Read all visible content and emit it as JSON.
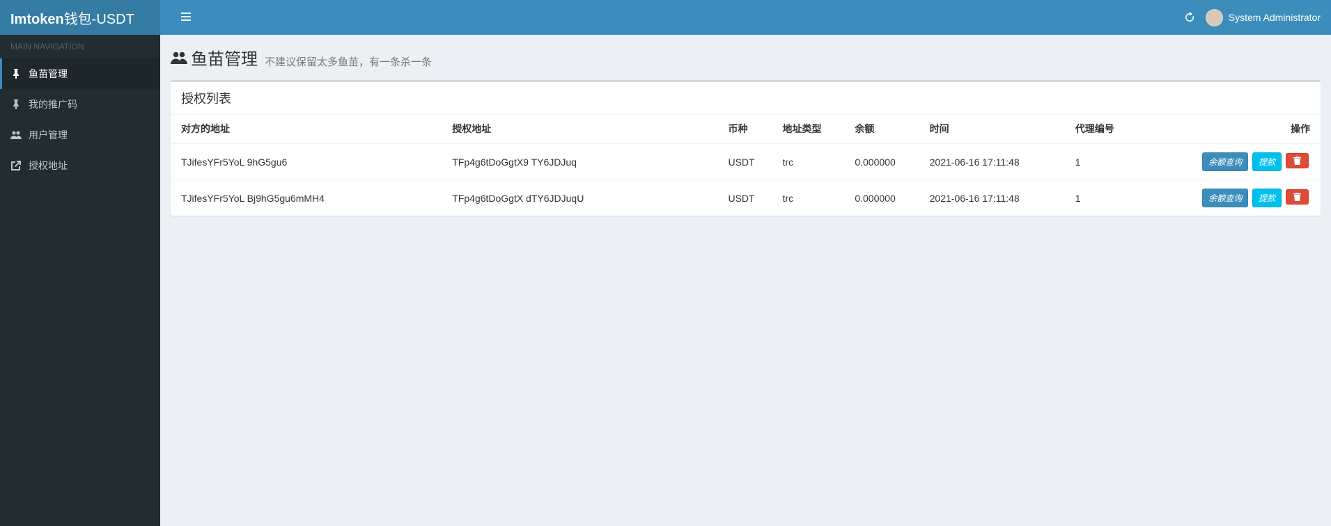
{
  "header": {
    "logo_bold": "Imtoken",
    "logo_rest": "钱包-USDT",
    "user_name": "System Administrator"
  },
  "sidebar": {
    "header": "MAIN NAVIGATION",
    "items": [
      {
        "label": "鱼苗管理",
        "icon": "pin"
      },
      {
        "label": "我的推广码",
        "icon": "pin"
      },
      {
        "label": "用户管理",
        "icon": "users"
      },
      {
        "label": "授权地址",
        "icon": "external"
      }
    ]
  },
  "page": {
    "title": "鱼苗管理",
    "subtitle": "不建议保留太多鱼苗，有一条杀一条"
  },
  "box": {
    "title": "授权列表"
  },
  "table": {
    "headers": {
      "target_address": "对方的地址",
      "auth_address": "授权地址",
      "currency": "币种",
      "addr_type": "地址类型",
      "balance": "余额",
      "time": "时间",
      "agent_id": "代理编号",
      "actions": "操作"
    },
    "rows": [
      {
        "target_address": "TJifesYFr5YoL          9hG5gu6",
        "auth_address": "TFp4g6tDoGgtX9          TY6JDJuq",
        "currency": "USDT",
        "addr_type": "trc",
        "balance": "0.000000",
        "time": "2021-06-16 17:11:48",
        "agent_id": "1"
      },
      {
        "target_address": "TJifesYFr5YoL        Bj9hG5gu6mMH4",
        "auth_address": "TFp4g6tDoGgtX          dTY6JDJuqU",
        "currency": "USDT",
        "addr_type": "trc",
        "balance": "0.000000",
        "time": "2021-06-16 17:11:48",
        "agent_id": "1"
      }
    ]
  },
  "buttons": {
    "balance_query": "余额查询",
    "withdraw": "提款"
  }
}
